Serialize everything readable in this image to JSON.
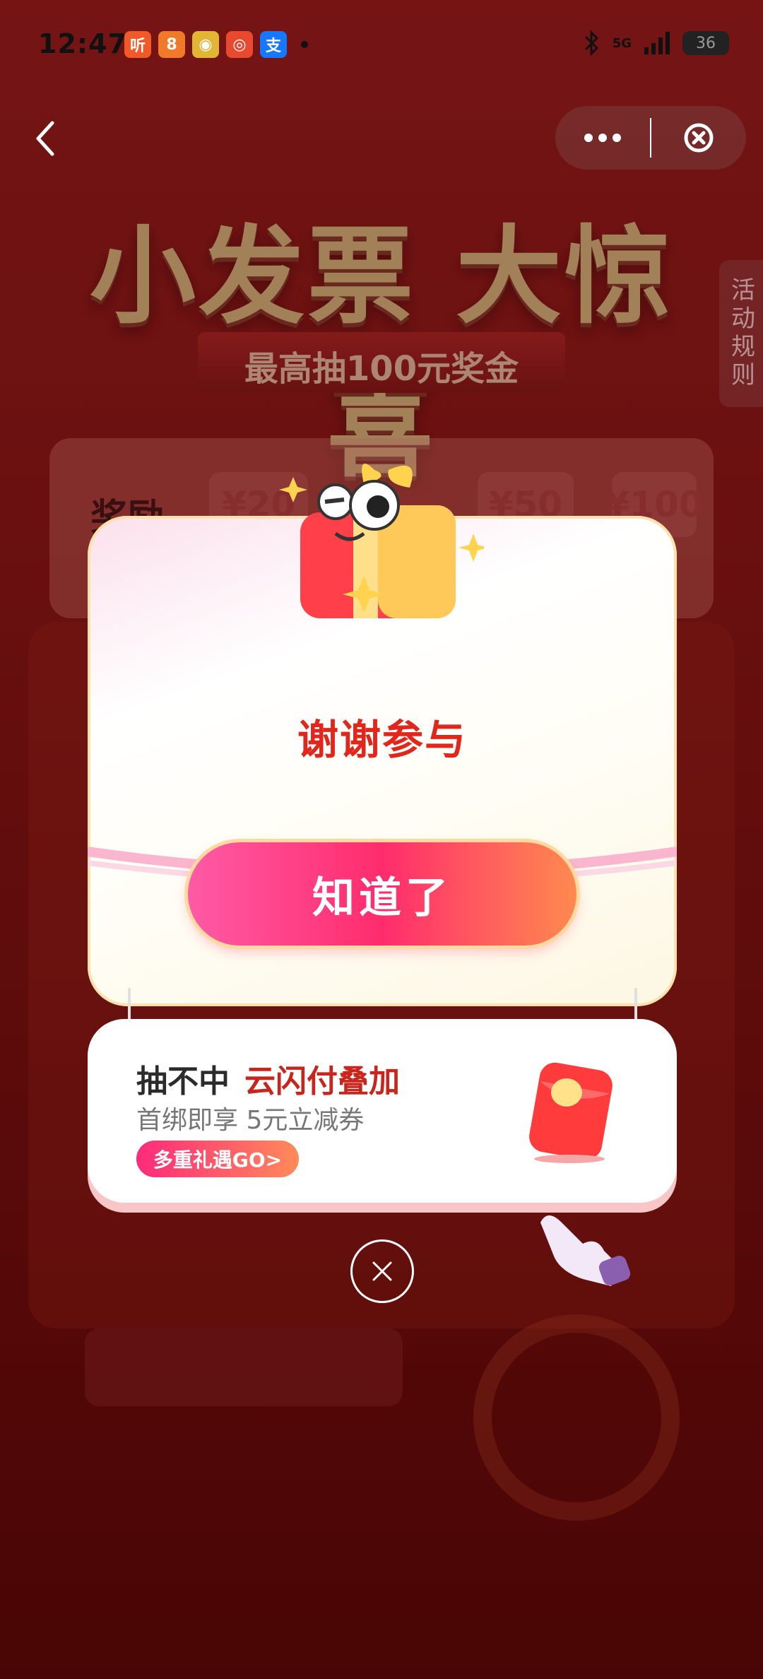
{
  "status_bar": {
    "time": "12:47",
    "apps": [
      {
        "name": "ting-app-icon",
        "glyph": "听",
        "color": "#f05a28"
      },
      {
        "name": "puzzle-app-icon",
        "glyph": "8",
        "color": "#f07a2a"
      },
      {
        "name": "weibo-app-icon",
        "glyph": "◉",
        "color": "#e2b534"
      },
      {
        "name": "red-app-icon",
        "glyph": "◎",
        "color": "#e84a2f"
      },
      {
        "name": "alipay-app-icon",
        "glyph": "支",
        "color": "#1677ff"
      }
    ],
    "signal_label": "5G",
    "battery": "36"
  },
  "page": {
    "headline": "小发票 大惊喜",
    "subhead": "最高抽100元奖金",
    "rules_tab": "活动规则",
    "reward_label": "奖励",
    "reward_chips": [
      "¥20",
      "¥50",
      "¥100"
    ]
  },
  "modal": {
    "result_text": "谢谢参与",
    "confirm_label": "知道了"
  },
  "promo": {
    "title_prefix": "抽不中",
    "title_highlight": "云闪付叠加",
    "subtitle": "首绑即享 5元立减券",
    "cta_label": "多重礼遇GO>"
  },
  "colors": {
    "accent_red": "#e1261c",
    "button_pink": "#ff2c6d"
  }
}
